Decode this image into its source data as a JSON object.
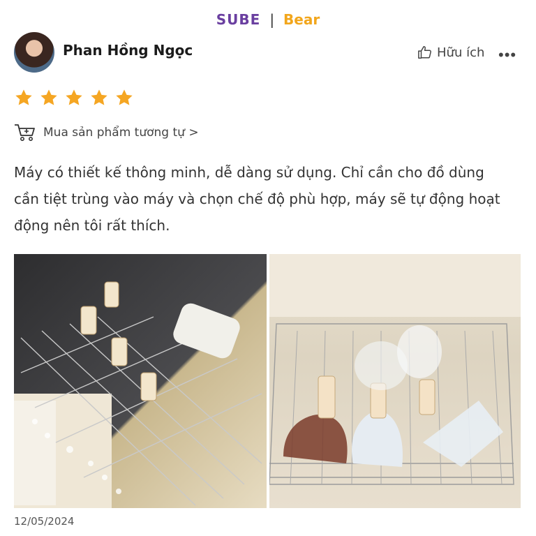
{
  "brand": {
    "left": "SUBE",
    "separator": "|",
    "right": "Bear"
  },
  "reviewer": {
    "name": "Phan Hồng Ngọc"
  },
  "actions": {
    "helpful_label": "Hữu ích",
    "more_label": "•••"
  },
  "rating": {
    "stars": 5,
    "max": 5,
    "color": "#f5a623"
  },
  "buy_similar": {
    "label": "Mua sản phẩm tương tự >"
  },
  "review": {
    "text": "Máy có thiết kế thông minh, dễ dàng sử dụng. Chỉ cần cho đồ dùng cần tiệt trùng vào máy và chọn chế độ phù hợp, máy sẽ tự động hoạt động nên tôi rất thích."
  },
  "photos": [
    {
      "description_icon": "sterilizer-photo"
    },
    {
      "description_icon": "bottles-photo"
    }
  ],
  "date": "12/05/2024"
}
